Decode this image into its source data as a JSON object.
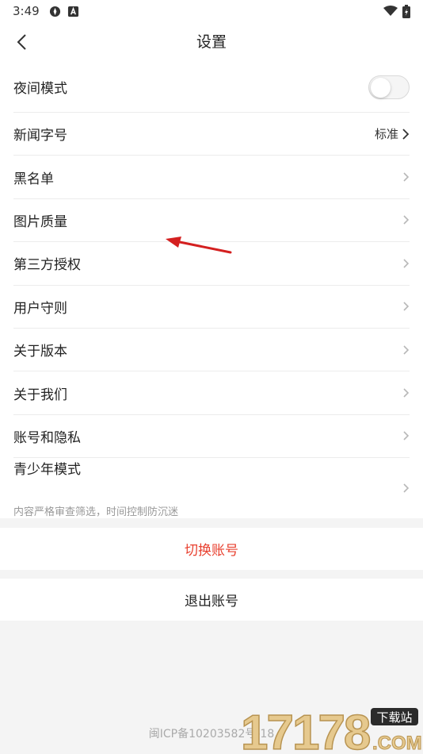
{
  "status_bar": {
    "time": "3:49",
    "icons": [
      "compass-icon",
      "text-a-icon",
      "wifi-icon",
      "battery-icon"
    ]
  },
  "header": {
    "title": "设置",
    "back_icon": "chevron-left-icon"
  },
  "settings": {
    "night_mode": {
      "label": "夜间模式",
      "enabled": false
    },
    "font_size": {
      "label": "新闻字号",
      "value": "标准"
    },
    "blacklist": {
      "label": "黑名单"
    },
    "image_quality": {
      "label": "图片质量"
    },
    "third_party": {
      "label": "第三方授权"
    },
    "user_rules": {
      "label": "用户守则"
    },
    "about_version": {
      "label": "关于版本"
    },
    "about_us": {
      "label": "关于我们"
    },
    "account_privacy": {
      "label": "账号和隐私"
    },
    "teen_mode": {
      "label": "青少年模式",
      "subtitle": "内容严格审查筛选，时间控制防沉迷"
    }
  },
  "actions": {
    "switch_account": "切换账号",
    "logout": "退出账号"
  },
  "footer": {
    "icp": "闽ICP备10203582号-18"
  },
  "watermark": {
    "logo_text": "17178",
    "badge": "下载站",
    "domain": ".COM"
  },
  "colors": {
    "accent_red": "#e8402f",
    "background": "#f4f4f4",
    "divider": "#ececec",
    "arrow_annotation": "#d42020"
  }
}
